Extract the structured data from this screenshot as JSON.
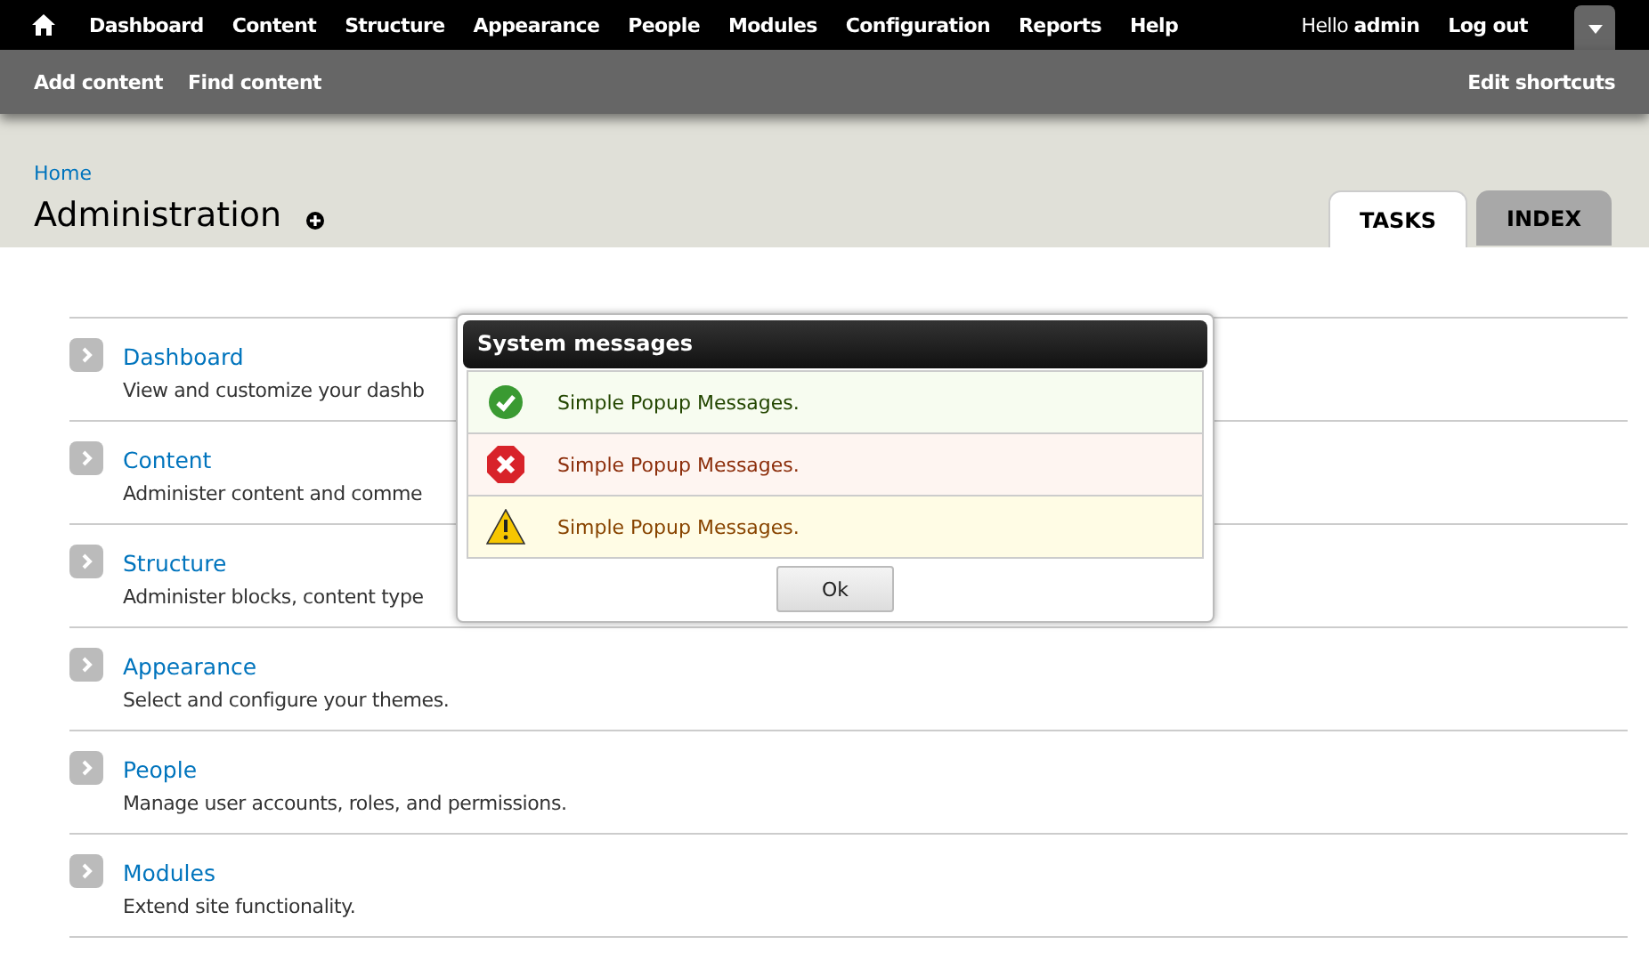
{
  "toolbar": {
    "menu": [
      "Dashboard",
      "Content",
      "Structure",
      "Appearance",
      "People",
      "Modules",
      "Configuration",
      "Reports",
      "Help"
    ],
    "greeting": "Hello **admin**",
    "logout": "Log out"
  },
  "shortcuts": {
    "items": [
      "Add content",
      "Find content"
    ],
    "edit": "Edit shortcuts"
  },
  "breadcrumb": "Home",
  "page_title": "Administration",
  "tabs": [
    {
      "label": "TASKS",
      "selected": true
    },
    {
      "label": "INDEX",
      "selected": false
    }
  ],
  "admin_items": [
    {
      "title": "Dashboard",
      "description": "View and customize your dashb"
    },
    {
      "title": "Content",
      "description": "Administer content and comme"
    },
    {
      "title": "Structure",
      "description": "Administer blocks, content type"
    },
    {
      "title": "Appearance",
      "description": "Select and configure your themes."
    },
    {
      "title": "People",
      "description": "Manage user accounts, roles, and permissions."
    },
    {
      "title": "Modules",
      "description": "Extend site functionality."
    }
  ],
  "popup": {
    "title": "System messages",
    "messages": [
      {
        "kind": "status",
        "text": "Simple Popup Messages."
      },
      {
        "kind": "error",
        "text": "Simple Popup Messages."
      },
      {
        "kind": "warning",
        "text": "Simple Popup Messages."
      }
    ],
    "button": "Ok"
  }
}
